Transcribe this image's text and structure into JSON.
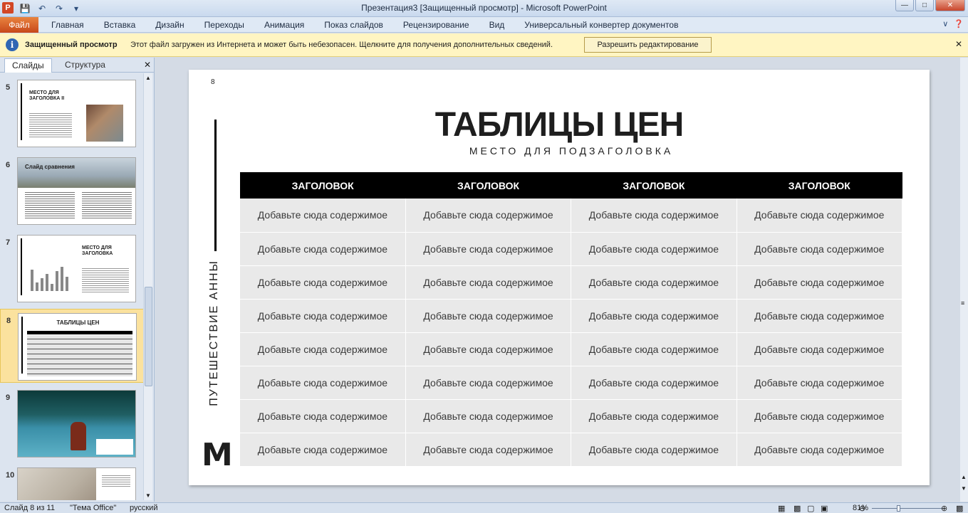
{
  "window": {
    "title": "Презентация3 [Защищенный просмотр]  -  Microsoft PowerPoint",
    "app_icon_letter": "P"
  },
  "ribbon": {
    "file_tab": "Файл",
    "tabs": [
      "Главная",
      "Вставка",
      "Дизайн",
      "Переходы",
      "Анимация",
      "Показ слайдов",
      "Рецензирование",
      "Вид",
      "Универсальный конвертер документов"
    ]
  },
  "message_bar": {
    "title": "Защищенный просмотр",
    "text": "Этот файл загружен из Интернета и может быть небезопасен. Щелкните для получения дополнительных сведений.",
    "button": "Разрешить редактирование"
  },
  "left_panel": {
    "tabs": [
      "Слайды",
      "Структура"
    ],
    "thumbnails": [
      {
        "number": "5",
        "title": "МЕСТО ДЛЯ ЗАГОЛОВКА II"
      },
      {
        "number": "6",
        "title": "Слайд сравнения"
      },
      {
        "number": "7",
        "title": "МЕСТО ДЛЯ ЗАГОЛОВКА"
      },
      {
        "number": "8",
        "title": "ТАБЛИЦЫ ЦЕН"
      },
      {
        "number": "9",
        "title": ""
      },
      {
        "number": "10",
        "title": ""
      }
    ]
  },
  "slide": {
    "number": "8",
    "title": "ТАБЛИЦЫ ЦЕН",
    "subtitle": "МЕСТО ДЛЯ ПОДЗАГОЛОВКА",
    "vertical_text": "ПУТЕШЕСТВИЕ АННЫ",
    "logo": "M",
    "table": {
      "headers": [
        "ЗАГОЛОВОК",
        "ЗАГОЛОВОК",
        "ЗАГОЛОВОК",
        "ЗАГОЛОВОК"
      ],
      "cell_text": "Добавьте сюда содержимое",
      "row_count": 8
    }
  },
  "status_bar": {
    "slide_info": "Слайд 8 из 11",
    "theme": "\"Тема Office\"",
    "language": "русский",
    "zoom": "81%"
  },
  "colors": {
    "file_tab": "#d24726",
    "message_bar_bg": "#fff5c2",
    "selected_thumb": "#fbe29e",
    "table_header_bg": "#000000",
    "table_cell_bg": "#e9e9e9"
  }
}
